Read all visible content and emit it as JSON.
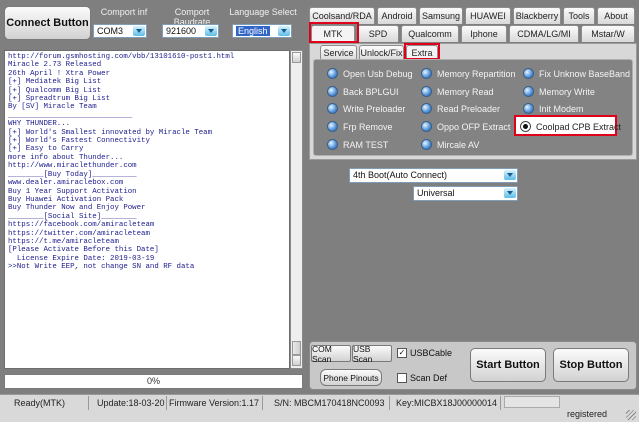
{
  "header": {
    "connect_label": "Connect Button",
    "comport_label": "Comport inf",
    "comport_value": "COM3",
    "baudrate_label": "Comport Baudrate",
    "baudrate_value": "921600",
    "language_label": "Language Select",
    "language_value": "English"
  },
  "top_tabs": [
    "Coolsand/RDA",
    "Android",
    "Samsung",
    "HUAWEI",
    "Blackberry",
    "Tools",
    "About"
  ],
  "second_tabs": [
    "MTK",
    "SPD",
    "Qualcomm",
    "Iphone",
    "CDMA/LG/MI",
    "Mstar/W"
  ],
  "sub_tabs": [
    "Service",
    "Unlock/Fix",
    "Extra"
  ],
  "options": {
    "col1": [
      "Open Usb Debug",
      "Back BPLGUI",
      "Write Preloader",
      "Frp Remove",
      "RAM TEST"
    ],
    "col2": [
      "Memory Repartition",
      "Memory Read",
      "Read Preloader",
      "Oppo OFP Extract",
      "Mircale AV"
    ],
    "col3": [
      "Fix Unknow BaseBand",
      "Memory Write",
      "Init Modem",
      "Coolpad CPB Extract"
    ]
  },
  "selected_option": "Coolpad CPB Extract",
  "boot_mode": "4th Boot(Auto Connect)",
  "chip": "Universal",
  "log_lines": [
    "http://forum.gsmhosting.com/vbb/13101610-post1.html",
    "Miracle 2.73 Released",
    "26th April ! Xtra Power",
    "[+] Mediatek Big List",
    "[+] Qualcomm Big List",
    "[+] Spreadtrum Big List",
    "By [SV] Miracle Team",
    "____________________________",
    "WHY THUNDER...",
    "[+] World's Smallest innovated by Miracle Team",
    "[+] World's Fastest Connectivity",
    "[+] Easy to Carry",
    "more info about Thunder...",
    "http://www.miraclethunder.com",
    "________[Buy Today]__________",
    "www.dealer.amiraclebox.com",
    "Buy 1 Year Support Activation",
    "Buy Huawei Activation Pack",
    "Buy Thunder Now and Enjoy Power",
    "________[Social Site]________",
    "https://facebook.com/amiracleteam",
    "https://twitter.com/amiracleteam",
    "https://t.me/amiracleteam",
    "[Please Activate Before this Date]",
    "  License Expire Date: 2019-03-19",
    ">>Not Write EEP, not change SN and RF data"
  ],
  "progress": {
    "value": 0,
    "label": "0%"
  },
  "bottom": {
    "com_scan": "COM Scan",
    "usb_scan": "USB Scan",
    "usbcable_label": "USBCable",
    "usbcable_checked": true,
    "phone_pinouts": "Phone Pinouts",
    "scan_def_label": "Scan Def",
    "scan_def_checked": false,
    "start_label": "Start Button",
    "stop_label": "Stop Button"
  },
  "status": {
    "ready": "Ready(MTK)",
    "update": "Update:18-03-20",
    "firmware": "Firmware Version:1.17",
    "sn": "S/N: MBCM170418NC0093",
    "key": "Key:MICBX18J00000014",
    "registered": "registered"
  },
  "colors": {
    "highlight": "#e0001b",
    "panel_dark": "#7f7f7f",
    "log_text": "#1b1b8c"
  }
}
